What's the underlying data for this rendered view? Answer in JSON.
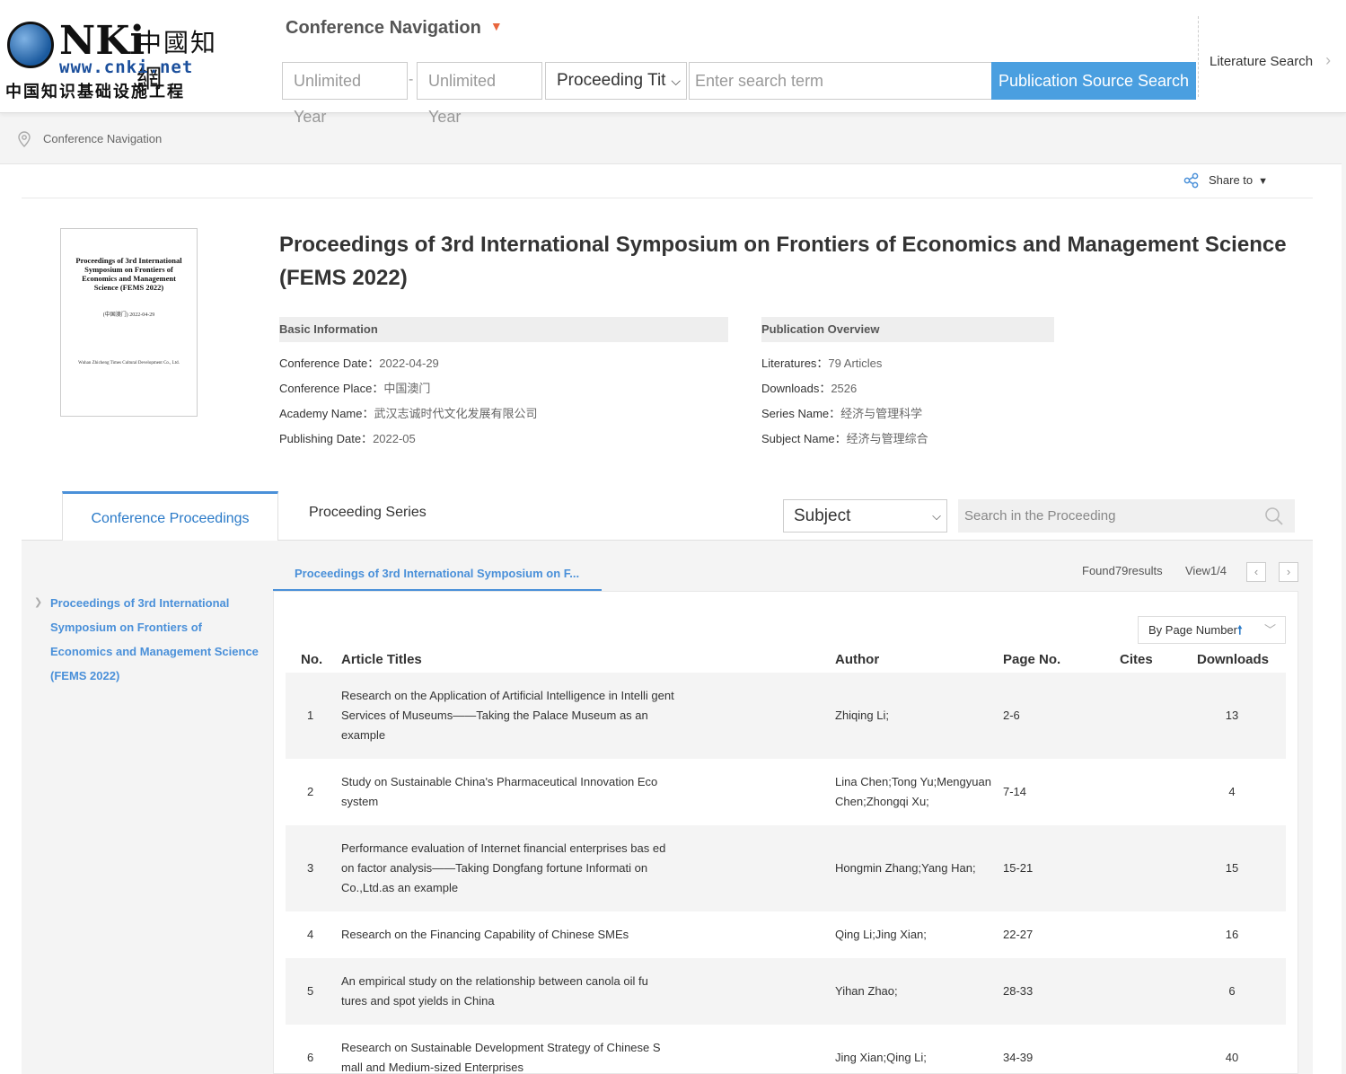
{
  "header": {
    "logo": {
      "latin": "NKi",
      "zh_name": "中國知網",
      "url": "www.cnki.net",
      "zh_subtitle": "中国知识基础设施工程"
    },
    "conference_navigation": "Conference Navigation",
    "year_from_placeholder": "Unlimited  Year",
    "year_to_placeholder": "Unlimited  Year",
    "year_separator": "-",
    "search_field_selected": "Proceeding Tit",
    "search_placeholder": "Enter search term",
    "search_button": "Publication Source Search",
    "literature_search": "Literature Search"
  },
  "breadcrumb": "Conference Navigation",
  "share_label": "Share to",
  "cover": {
    "title": "Proceedings of 3rd International Symposium on Frontiers of Economics and Management Science (FEMS 2022)",
    "date_line": "(中国澳门)       2022-04-29",
    "publisher_line": "Wuhan Zhicheng Times Cultural Development Co., Ltd."
  },
  "title": "Proceedings of 3rd International Symposium on Frontiers of Economics and Management Science (FEMS 2022)",
  "basic_info": {
    "heading": "Basic Information",
    "rows": [
      {
        "label": "Conference Date：",
        "value": "2022-04-29"
      },
      {
        "label": "Conference Place：",
        "value": "中国澳门"
      },
      {
        "label": "Academy Name：",
        "value": "武汉志诚时代文化发展有限公司"
      },
      {
        "label": "Publishing Date：",
        "value": "2022-05"
      }
    ]
  },
  "overview": {
    "heading": "Publication Overview",
    "rows": [
      {
        "label": "Literatures：",
        "value": "79 Articles"
      },
      {
        "label": "Downloads：",
        "value": "2526"
      },
      {
        "label": "Series Name：",
        "value": "经济与管理科学"
      },
      {
        "label": "Subject Name：",
        "value": "经济与管理综合"
      }
    ]
  },
  "tabs": {
    "active": "Conference Proceedings",
    "other": "Proceeding Series"
  },
  "filter": {
    "subject": "Subject",
    "search_placeholder": "Search in the Proceeding"
  },
  "sidebar": {
    "item": "Proceedings of 3rd International Symposium on Frontiers of Economics and Management Science (FEMS 2022)"
  },
  "list": {
    "subtab": "Proceedings of 3rd International Symposium on F...",
    "found": "Found79results",
    "view": "View1/4",
    "sort_label": "By Page Number",
    "columns": {
      "no": "No.",
      "title": "Article Titles",
      "author": "Author",
      "page": "Page No.",
      "cites": "Cites",
      "downloads": "Downloads"
    },
    "rows": [
      {
        "no": "1",
        "title": "Research on the Application of Artificial Intelligence in Intelli gent Services of Museums——Taking the Palace Museum as an example",
        "author": "Zhiqing Li;",
        "page": "2-6",
        "cites": "",
        "downloads": "13"
      },
      {
        "no": "2",
        "title": "Study on Sustainable China's Pharmaceutical Innovation Eco system",
        "author": "Lina Chen;Tong Yu;Mengyuan Chen;Zhongqi Xu;",
        "page": "7-14",
        "cites": "",
        "downloads": "4"
      },
      {
        "no": "3",
        "title": "Performance evaluation of Internet financial enterprises bas ed on factor analysis——Taking Dongfang fortune Informati on Co.,Ltd.as an example",
        "author": "Hongmin Zhang;Yang Han;",
        "page": "15-21",
        "cites": "",
        "downloads": "15"
      },
      {
        "no": "4",
        "title": "Research on the Financing Capability of Chinese SMEs",
        "author": "Qing Li;Jing Xian;",
        "page": "22-27",
        "cites": "",
        "downloads": "16"
      },
      {
        "no": "5",
        "title": "An empirical study on the relationship between canola oil fu tures and spot yields in China",
        "author": "Yihan Zhao;",
        "page": "28-33",
        "cites": "",
        "downloads": "6"
      },
      {
        "no": "6",
        "title": "Research on Sustainable Development Strategy of Chinese S mall and Medium-sized Enterprises",
        "author": "Jing Xian;Qing Li;",
        "page": "34-39",
        "cites": "",
        "downloads": "40"
      }
    ]
  },
  "colors": {
    "accent": "#4a9fe0",
    "link": "#4a90d9",
    "nav_arrow": "#e8663d"
  }
}
